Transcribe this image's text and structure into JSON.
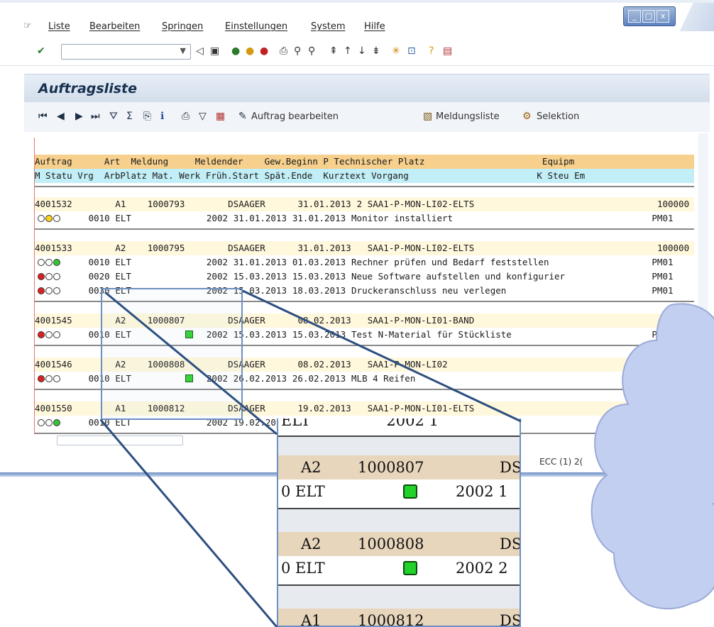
{
  "menu": {
    "items": [
      "Liste",
      "Bearbeiten",
      "Springen",
      "Einstellungen",
      "System",
      "Hilfe"
    ]
  },
  "window_controls": [
    "_",
    "□",
    "x"
  ],
  "toolbar": {
    "command_field_value": ""
  },
  "screen": {
    "title": "Auftragsliste"
  },
  "app_toolbar": {
    "edit_order": "Auftrag bearbeiten",
    "notification_list": "Meldungsliste",
    "selection": "Selektion"
  },
  "table": {
    "header1": "Auftrag      Art  Meldung     Meldender    Gew.Beginn P Technischer Platz                      Equipm",
    "header2": "M Statu Vrg  ArbPlatz Mat. Werk Früh.Start Spät.Ende  Kurztext Vorgang                        K Steu Em",
    "orders": [
      {
        "order": "4001532",
        "art": "A1",
        "meldung": "1000793",
        "melder": "DSAAGER",
        "date": "31.01.2013",
        "prio": "2",
        "tplatz": "SAA1-P-MON-LI02-ELTS",
        "equip": "100000",
        "ops": [
          {
            "status": "yellow",
            "vrg": "0010",
            "arb": "ELT",
            "mat": false,
            "werk": "2002",
            "start": "31.01.2013",
            "end": "31.01.2013",
            "text": "Monitor installiert",
            "steu": "PM01"
          }
        ]
      },
      {
        "order": "4001533",
        "art": "A2",
        "meldung": "1000795",
        "melder": "DSAAGER",
        "date": "31.01.2013",
        "prio": "",
        "tplatz": "SAA1-P-MON-LI02-ELTS",
        "equip": "100000",
        "ops": [
          {
            "status": "green",
            "vrg": "0010",
            "arb": "ELT",
            "mat": false,
            "werk": "2002",
            "start": "31.01.2013",
            "end": "01.03.2013",
            "text": "Rechner prüfen und Bedarf feststellen",
            "steu": "PM01"
          },
          {
            "status": "red",
            "vrg": "0020",
            "arb": "ELT",
            "mat": false,
            "werk": "2002",
            "start": "15.03.2013",
            "end": "15.03.2013",
            "text": "Neue Software aufstellen und konfigurier",
            "steu": "PM01"
          },
          {
            "status": "red",
            "vrg": "0030",
            "arb": "ELT",
            "mat": false,
            "werk": "2002",
            "start": "15.03.2013",
            "end": "18.03.2013",
            "text": "Druckeranschluss neu verlegen",
            "steu": "PM01"
          }
        ]
      },
      {
        "order": "4001545",
        "art": "A2",
        "meldung": "1000807",
        "melder": "DSAAGER",
        "date": "08.02.2013",
        "prio": "",
        "tplatz": "SAA1-P-MON-LI01-BAND",
        "equip": "",
        "ops": [
          {
            "status": "red",
            "vrg": "0010",
            "arb": "ELT",
            "mat": true,
            "werk": "2002",
            "start": "15.03.2013",
            "end": "15.03.2013",
            "text": "Test N-Material für Stückliste",
            "steu": "PM01"
          }
        ]
      },
      {
        "order": "4001546",
        "art": "A2",
        "meldung": "1000808",
        "melder": "DSAAGER",
        "date": "08.02.2013",
        "prio": "",
        "tplatz": "SAA1-P-MON-LI02",
        "equip": "",
        "ops": [
          {
            "status": "red",
            "vrg": "0010",
            "arb": "ELT",
            "mat": true,
            "werk": "2002",
            "start": "26.02.2013",
            "end": "26.02.2013",
            "text": "MLB 4 Reifen",
            "steu": ""
          }
        ]
      },
      {
        "order": "4001550",
        "art": "A1",
        "meldung": "1000812",
        "melder": "DSAAGER",
        "date": "19.02.2013",
        "prio": "",
        "tplatz": "SAA1-P-MON-LI01-ELTS",
        "equip": "",
        "ops": [
          {
            "status": "green",
            "vrg": "0010",
            "arb": "ELT",
            "mat": false,
            "werk": "2002",
            "start": "19.02.2013",
            "end": "",
            "text": "",
            "steu": ""
          }
        ]
      }
    ]
  },
  "status_bar": {
    "system": "ECC (1) 2("
  },
  "zoom": {
    "top_partial": "ELT                2002 1",
    "rows": [
      {
        "art": "A2",
        "meldung": "1000807",
        "melder": "DS",
        "arb": "ELT",
        "werk": "2002",
        "day": "1"
      },
      {
        "art": "A2",
        "meldung": "1000808",
        "melder": "DS",
        "arb": "ELT",
        "werk": "2002",
        "day": "2"
      },
      {
        "art": "A1",
        "meldung": "1000812",
        "melder": "DS"
      }
    ]
  },
  "colors": {
    "header_orange": "#f6d08c",
    "header_cyan": "#c2eef7",
    "main_row": "#fff8dc",
    "accent": "#6d8fc1"
  }
}
